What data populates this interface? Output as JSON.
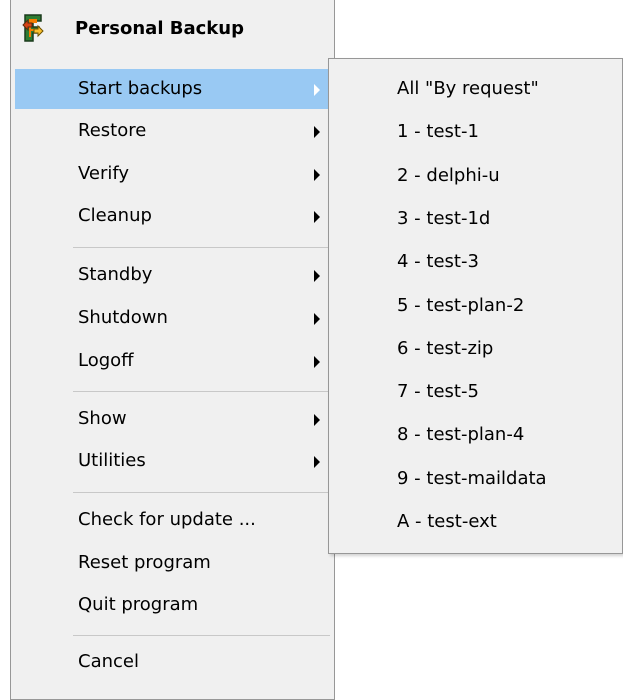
{
  "main_menu": {
    "title": "Personal Backup",
    "icon": "personal-backup-app-icon",
    "highlight_color": "#99c9f3",
    "items": [
      {
        "label": "Start backups",
        "submenu": true,
        "highlighted": true
      },
      {
        "label": "Restore",
        "submenu": true
      },
      {
        "label": "Verify",
        "submenu": true
      },
      {
        "label": "Cleanup",
        "submenu": true
      },
      {
        "label": "Standby",
        "submenu": true
      },
      {
        "label": "Shutdown",
        "submenu": true
      },
      {
        "label": "Logoff",
        "submenu": true
      },
      {
        "label": "Show",
        "submenu": true
      },
      {
        "label": "Utilities",
        "submenu": true
      },
      {
        "label": "Check for update ...",
        "submenu": false
      },
      {
        "label": "Reset program",
        "submenu": false
      },
      {
        "label": "Quit program",
        "submenu": false
      },
      {
        "label": "Cancel",
        "submenu": false
      }
    ]
  },
  "start_backups_submenu": {
    "items": [
      {
        "label": "All \"By request\""
      },
      {
        "label": "1 - test-1"
      },
      {
        "label": "2 - delphi-u"
      },
      {
        "label": "3 - test-1d"
      },
      {
        "label": "4 - test-3"
      },
      {
        "label": "5 - test-plan-2"
      },
      {
        "label": "6 - test-zip"
      },
      {
        "label": "7 - test-5"
      },
      {
        "label": "8 - test-plan-4"
      },
      {
        "label": "9 - test-maildata"
      },
      {
        "label": "A - test-ext"
      }
    ]
  }
}
